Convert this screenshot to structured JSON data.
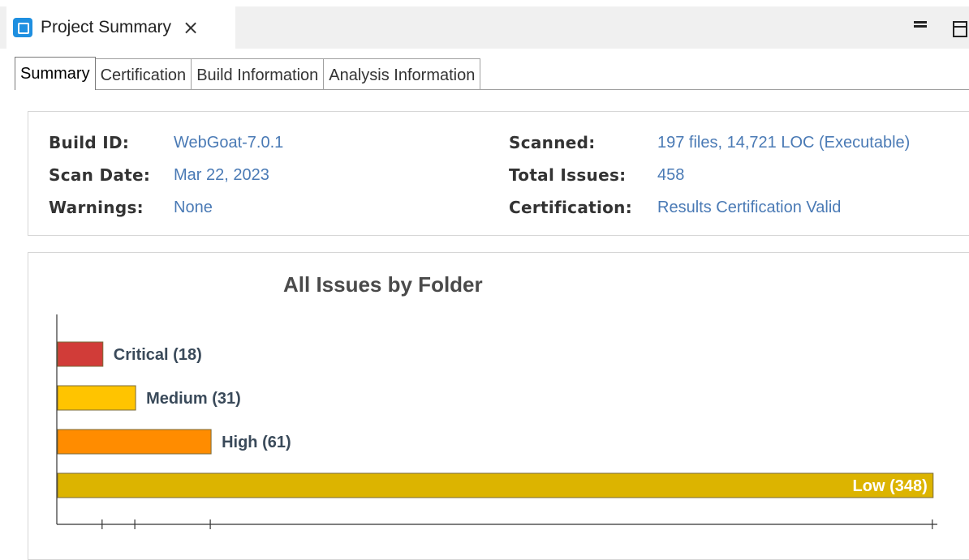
{
  "view": {
    "title": "Project Summary",
    "close_glyph": "×",
    "icon": "project-summary-icon"
  },
  "tabs": [
    {
      "label": "Summary",
      "active": true
    },
    {
      "label": "Certification",
      "active": false
    },
    {
      "label": "Build Information",
      "active": false
    },
    {
      "label": "Analysis Information",
      "active": false
    }
  ],
  "info": {
    "build_id_label": "Build ID:",
    "build_id": "WebGoat-7.0.1",
    "scan_date_label": "Scan Date:",
    "scan_date": "Mar 22, 2023",
    "warnings_label": "Warnings:",
    "warnings": "None",
    "scanned_label": "Scanned:",
    "scanned": "197 files, 14,721 LOC (Executable)",
    "total_issues_label": "Total Issues:",
    "total_issues": "458",
    "certification_label": "Certification:",
    "certification": "Results Certification Valid"
  },
  "chart_data": {
    "type": "bar",
    "orientation": "horizontal",
    "title": "All Issues by Folder",
    "categories": [
      "Critical",
      "Medium",
      "High",
      "Low"
    ],
    "labels": [
      "Critical (18)",
      "Medium (31)",
      "High (61)",
      "Low (348)"
    ],
    "values": [
      18,
      31,
      61,
      348
    ],
    "colors": [
      "#d13c38",
      "#ffc400",
      "#ff8c00",
      "#dcb400"
    ],
    "xlim": [
      0,
      350
    ],
    "xticks": [
      18,
      31,
      61,
      348
    ],
    "grid": false,
    "legend": "none"
  }
}
